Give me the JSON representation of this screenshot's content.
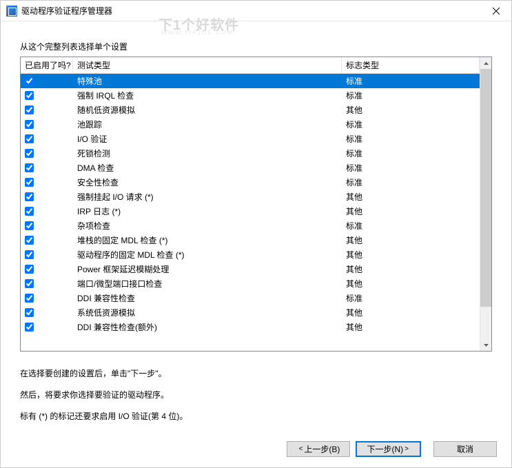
{
  "window": {
    "title": "驱动程序验证程序管理器"
  },
  "watermark": {
    "line1": "下1个好软件",
    "line2": "WWW.XIA1GE.COM"
  },
  "list_label": "从这个完整列表选择单个设置",
  "columns": {
    "enabled": "已启用了吗?",
    "test_type": "测试类型",
    "flag_type": "标志类型"
  },
  "rows": [
    {
      "checked": true,
      "selected": true,
      "test": "特殊池",
      "flag": "标准"
    },
    {
      "checked": true,
      "selected": false,
      "test": "强制 IRQL 检查",
      "flag": "标准"
    },
    {
      "checked": true,
      "selected": false,
      "test": "随机低资源模拟",
      "flag": "其他"
    },
    {
      "checked": true,
      "selected": false,
      "test": "池跟踪",
      "flag": "标准"
    },
    {
      "checked": true,
      "selected": false,
      "test": "I/O 验证",
      "flag": "标准"
    },
    {
      "checked": true,
      "selected": false,
      "test": "死锁检测",
      "flag": "标准"
    },
    {
      "checked": true,
      "selected": false,
      "test": "DMA 检查",
      "flag": "标准"
    },
    {
      "checked": true,
      "selected": false,
      "test": "安全性检查",
      "flag": "标准"
    },
    {
      "checked": true,
      "selected": false,
      "test": "强制挂起 I/O 请求 (*)",
      "flag": "其他"
    },
    {
      "checked": true,
      "selected": false,
      "test": "IRP 日志 (*)",
      "flag": "其他"
    },
    {
      "checked": true,
      "selected": false,
      "test": "杂项检查",
      "flag": "标准"
    },
    {
      "checked": true,
      "selected": false,
      "test": "堆栈的固定 MDL 检查 (*)",
      "flag": "其他"
    },
    {
      "checked": true,
      "selected": false,
      "test": "驱动程序的固定 MDL 检查 (*)",
      "flag": "其他"
    },
    {
      "checked": true,
      "selected": false,
      "test": "Power 框架延迟模糊处理",
      "flag": "其他"
    },
    {
      "checked": true,
      "selected": false,
      "test": "端口/微型端口接口检查",
      "flag": "其他"
    },
    {
      "checked": true,
      "selected": false,
      "test": "DDI 兼容性检查",
      "flag": "标准"
    },
    {
      "checked": true,
      "selected": false,
      "test": "系统低资源模拟",
      "flag": "其他"
    },
    {
      "checked": true,
      "selected": false,
      "test": "DDI 兼容性检查(额外)",
      "flag": "其他"
    }
  ],
  "footer": {
    "line1": "在选择要创建的设置后，单击\"下一步\"。",
    "line2": "然后，将要求你选择要验证的驱动程序。",
    "line3": "标有 (*) 的标记还要求启用 I/O 验证(第 4 位)。"
  },
  "buttons": {
    "back": "上一步(B)",
    "next": "下一步(N)",
    "cancel": "取消"
  }
}
